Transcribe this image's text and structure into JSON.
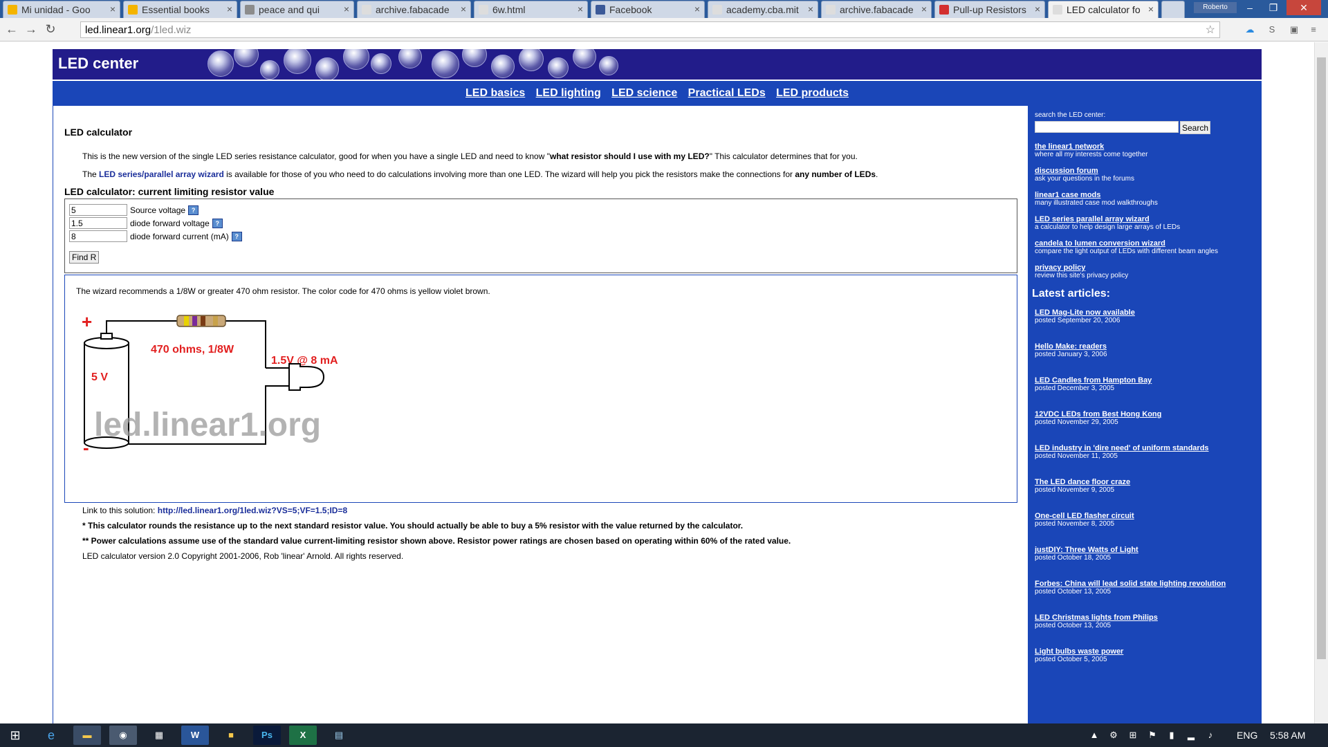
{
  "browser": {
    "tabs": [
      {
        "title": "Mi unidad - Goo",
        "icon": "drive-icon"
      },
      {
        "title": "Essential books",
        "icon": "drive-icon"
      },
      {
        "title": "peace and qui",
        "icon": "link-icon"
      },
      {
        "title": "archive.fabacade",
        "icon": "page-icon"
      },
      {
        "title": "6w.html",
        "icon": "page-icon"
      },
      {
        "title": "Facebook",
        "icon": "facebook-icon"
      },
      {
        "title": "academy.cba.mit",
        "icon": "page-icon"
      },
      {
        "title": "archive.fabacade",
        "icon": "page-icon"
      },
      {
        "title": "Pull-up Resistors",
        "icon": "pdf-icon"
      },
      {
        "title": "LED calculator fo",
        "icon": "page-icon"
      }
    ],
    "profile_name": "Roberto",
    "url_host": "led.linear1.org",
    "url_path": "/1led.wiz"
  },
  "site": {
    "title": "LED center",
    "nav": [
      "LED basics",
      "LED lighting",
      "LED science",
      "Practical LEDs",
      "LED products"
    ]
  },
  "main": {
    "heading": "LED calculator",
    "intro_1_a": "This is the new version of the single LED series resistance calculator, good for when you have a single LED and need to know \"",
    "intro_1_b": "what resistor should I use with my LED?",
    "intro_1_c": "\" This calculator determines that for you.",
    "intro_2_a": "The ",
    "intro_2_link": "LED series/parallel array wizard",
    "intro_2_b": " is available for those of you who need to do calculations involving more than one LED. The wizard will help you pick the resistors make the connections for ",
    "intro_2_c": "any number of LEDs",
    "intro_2_d": ".",
    "form_heading": "LED calculator: current limiting resistor value",
    "fields": [
      {
        "value": "5",
        "label": "Source voltage"
      },
      {
        "value": "1.5",
        "label": "diode forward voltage"
      },
      {
        "value": "8",
        "label": "diode forward current (mA)"
      }
    ],
    "find_button": "Find R",
    "result_text": "The wizard recommends a 1/8W or greater 470 ohm resistor. The color code for 470 ohms is yellow violet brown.",
    "diagram": {
      "plus": "+",
      "minus": "-",
      "battery_label": "5 V",
      "resistor_label": "470 ohms, 1/8W",
      "led_label": "1.5V @ 8 mA",
      "watermark": "led.linear1.org",
      "band_colors": [
        "#e8d200",
        "#7a2a9a",
        "#7a3b14",
        "#c8a24a"
      ]
    },
    "link_label": "Link to this solution: ",
    "link_url": "http://led.linear1.org/1led.wiz?VS=5;VF=1.5;ID=8",
    "note_1": "* This calculator rounds the resistance up to the next standard resistor value. You should actually be able to buy a 5% resistor with the value returned by the calculator.",
    "note_2": "** Power calculations assume use of the standard value current-limiting resistor shown above. Resistor power ratings are chosen based on operating within 60% of the rated value.",
    "copyright": "LED calculator version 2.0 Copyright 2001-2006, Rob 'linear' Arnold. All rights reserved."
  },
  "sidebar": {
    "search_label": "search the LED center:",
    "search_button": "Search",
    "links": [
      {
        "title": "the linear1 network",
        "desc": "where all my interests come together"
      },
      {
        "title": "discussion forum",
        "desc": "ask your questions in the forums"
      },
      {
        "title": "linear1 case mods",
        "desc": "many illustrated case mod walkthroughs"
      },
      {
        "title": "LED series parallel array wizard",
        "desc": "a calculator to help design large arrays of LEDs"
      },
      {
        "title": "candela to lumen conversion wizard",
        "desc": "compare the light output of LEDs with different beam angles"
      },
      {
        "title": "privacy policy",
        "desc": "review this site's privacy policy"
      }
    ],
    "latest_heading": "Latest articles:",
    "articles": [
      {
        "title": "LED Mag-Lite now available",
        "date": "posted September 20, 2006"
      },
      {
        "title": "Hello Make: readers",
        "date": "posted January 3, 2006"
      },
      {
        "title": "LED Candles from Hampton Bay",
        "date": "posted December 3, 2005"
      },
      {
        "title": "12VDC LEDs from Best Hong Kong",
        "date": "posted November 29, 2005"
      },
      {
        "title": "LED industry in 'dire need' of uniform standards",
        "date": "posted November 11, 2005"
      },
      {
        "title": "The LED dance floor craze",
        "date": "posted November 9, 2005"
      },
      {
        "title": "One-cell LED flasher circuit",
        "date": "posted November 8, 2005"
      },
      {
        "title": "justDIY: Three Watts of Light",
        "date": "posted October 18, 2005"
      },
      {
        "title": "Forbes: China will lead solid state lighting revolution",
        "date": "posted October 13, 2005"
      },
      {
        "title": "LED Christmas lights from Philips",
        "date": "posted October 13, 2005"
      },
      {
        "title": "Light bulbs waste power",
        "date": "posted October 5, 2005"
      }
    ]
  },
  "taskbar": {
    "language": "ENG",
    "time": "5:58 AM",
    "apps": [
      "start-icon",
      "ie-icon",
      "explorer-icon",
      "chrome-icon",
      "app-icon",
      "word-icon",
      "folder-icon",
      "photoshop-icon",
      "excel-icon",
      "notepad-icon"
    ]
  }
}
